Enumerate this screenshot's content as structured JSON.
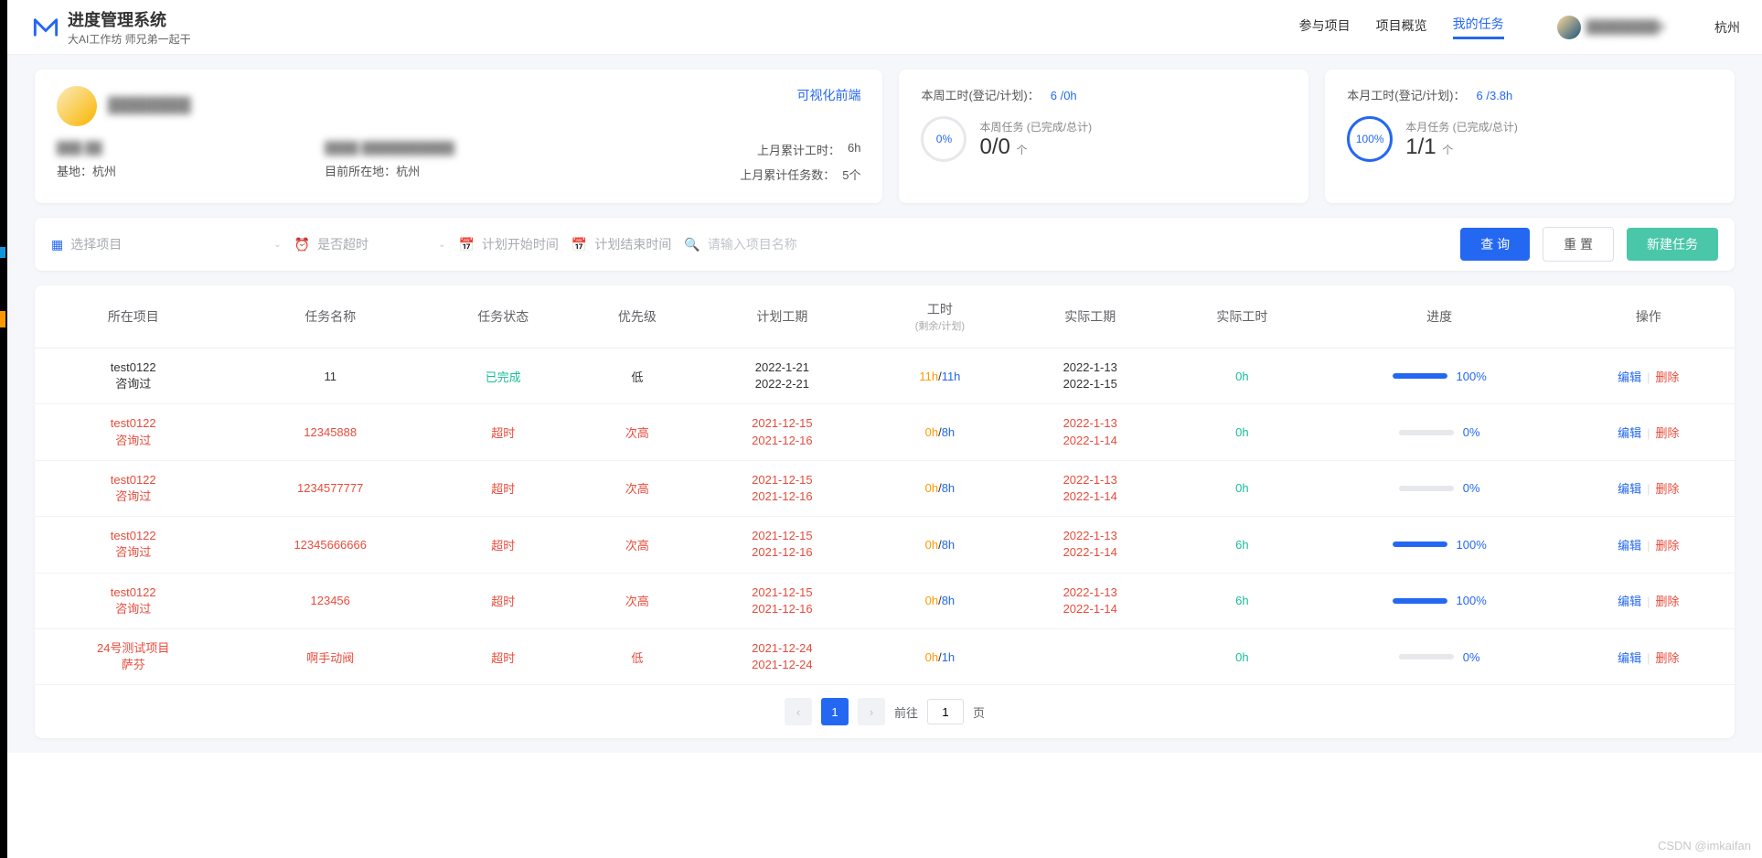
{
  "brand": {
    "title": "进度管理系统",
    "subtitle": "大AI工作坊 师兄弟一起干"
  },
  "nav": {
    "items": [
      "参与项目",
      "项目概览",
      "我的任务"
    ],
    "active": 2,
    "location": "杭州"
  },
  "user": {
    "name_masked": "████████▾"
  },
  "info_card": {
    "name_masked": "████████",
    "link": "可视化前端",
    "rows_left": [
      {
        "label_masked": "███ ██",
        "value": ""
      },
      {
        "label": "基地：",
        "value": "杭州"
      }
    ],
    "rows_mid": [
      {
        "label_masked": "████ ███████████",
        "value": ""
      },
      {
        "label": "目前所在地：",
        "value": "杭州"
      }
    ],
    "rows_right": [
      {
        "label": "上月累计工时：",
        "value": "6h"
      },
      {
        "label": "上月累计任务数：",
        "value": "5个"
      }
    ]
  },
  "stat_week": {
    "title": "本周工时(登记/计划)：",
    "value": "6 /0h",
    "ring": "0%",
    "sub_label": "本周任务 (已完成/总计)",
    "big": "0/0",
    "unit": "个"
  },
  "stat_month": {
    "title": "本月工时(登记/计划)：",
    "value": "6 /3.8h",
    "ring": "100%",
    "sub_label": "本月任务 (已完成/总计)",
    "big": "1/1",
    "unit": "个"
  },
  "toolbar": {
    "select_project": "选择项目",
    "overtime": "是否超时",
    "start_date": "计划开始时间",
    "end_date": "计划结束时间",
    "search_placeholder": "请输入项目名称",
    "btn_query": "查 询",
    "btn_reset": "重 置",
    "btn_new": "新建任务"
  },
  "table": {
    "headers": [
      "所在项目",
      "任务名称",
      "任务状态",
      "优先级",
      "计划工期",
      "工时",
      "实际工期",
      "实际工时",
      "进度",
      "操作"
    ],
    "headers_sub": "(剩余/计划)",
    "rows": [
      {
        "proj": [
          "test0122",
          "咨询过"
        ],
        "proj_red": false,
        "name": "11",
        "name_red": false,
        "status": "已完成",
        "status_cls": "green",
        "prio": "低",
        "prio_red": false,
        "plan": [
          "2022-1-21",
          "2022-2-21"
        ],
        "plan_red": false,
        "hours_a": "11h",
        "hours_a_cls": "orange",
        "hours_b": "11h",
        "actual": [
          "2022-1-13",
          "2022-1-15"
        ],
        "actual_red": false,
        "ah": "0h",
        "prog": 100,
        "prog_txt": "100%"
      },
      {
        "proj": [
          "test0122",
          "咨询过"
        ],
        "proj_red": true,
        "name": "12345888",
        "name_red": true,
        "status": "超时",
        "status_cls": "red",
        "prio": "次高",
        "prio_red": true,
        "plan": [
          "2021-12-15",
          "2021-12-16"
        ],
        "plan_red": true,
        "hours_a": "0h",
        "hours_a_cls": "orange",
        "hours_b": "8h",
        "actual": [
          "2022-1-13",
          "2022-1-14"
        ],
        "actual_red": true,
        "ah": "0h",
        "prog": 0,
        "prog_txt": "0%"
      },
      {
        "proj": [
          "test0122",
          "咨询过"
        ],
        "proj_red": true,
        "name": "1234577777",
        "name_red": true,
        "status": "超时",
        "status_cls": "red",
        "prio": "次高",
        "prio_red": true,
        "plan": [
          "2021-12-15",
          "2021-12-16"
        ],
        "plan_red": true,
        "hours_a": "0h",
        "hours_a_cls": "orange",
        "hours_b": "8h",
        "actual": [
          "2022-1-13",
          "2022-1-14"
        ],
        "actual_red": true,
        "ah": "0h",
        "prog": 0,
        "prog_txt": "0%"
      },
      {
        "proj": [
          "test0122",
          "咨询过"
        ],
        "proj_red": true,
        "name": "12345666666",
        "name_red": true,
        "status": "超时",
        "status_cls": "red",
        "prio": "次高",
        "prio_red": true,
        "plan": [
          "2021-12-15",
          "2021-12-16"
        ],
        "plan_red": true,
        "hours_a": "0h",
        "hours_a_cls": "orange",
        "hours_b": "8h",
        "actual": [
          "2022-1-13",
          "2022-1-14"
        ],
        "actual_red": true,
        "ah": "6h",
        "prog": 100,
        "prog_txt": "100%"
      },
      {
        "proj": [
          "test0122",
          "咨询过"
        ],
        "proj_red": true,
        "name": "123456",
        "name_red": true,
        "status": "超时",
        "status_cls": "red",
        "prio": "次高",
        "prio_red": true,
        "plan": [
          "2021-12-15",
          "2021-12-16"
        ],
        "plan_red": true,
        "hours_a": "0h",
        "hours_a_cls": "orange",
        "hours_b": "8h",
        "actual": [
          "2022-1-13",
          "2022-1-14"
        ],
        "actual_red": true,
        "ah": "6h",
        "prog": 100,
        "prog_txt": "100%"
      },
      {
        "proj": [
          "24号测试项目",
          "萨芬"
        ],
        "proj_red": true,
        "name": "啊手动阀",
        "name_red": true,
        "status": "超时",
        "status_cls": "red",
        "prio": "低",
        "prio_red": true,
        "plan": [
          "2021-12-24",
          "2021-12-24"
        ],
        "plan_red": true,
        "hours_a": "0h",
        "hours_a_cls": "orange",
        "hours_b": "1h",
        "actual": [
          "",
          ""
        ],
        "actual_red": false,
        "ah": "0h",
        "prog": 0,
        "prog_txt": "0%"
      }
    ],
    "op_edit": "编辑",
    "op_delete": "删除"
  },
  "pager": {
    "goto": "前往",
    "page": "1",
    "unit": "页"
  },
  "watermark": "CSDN @imkaifan"
}
